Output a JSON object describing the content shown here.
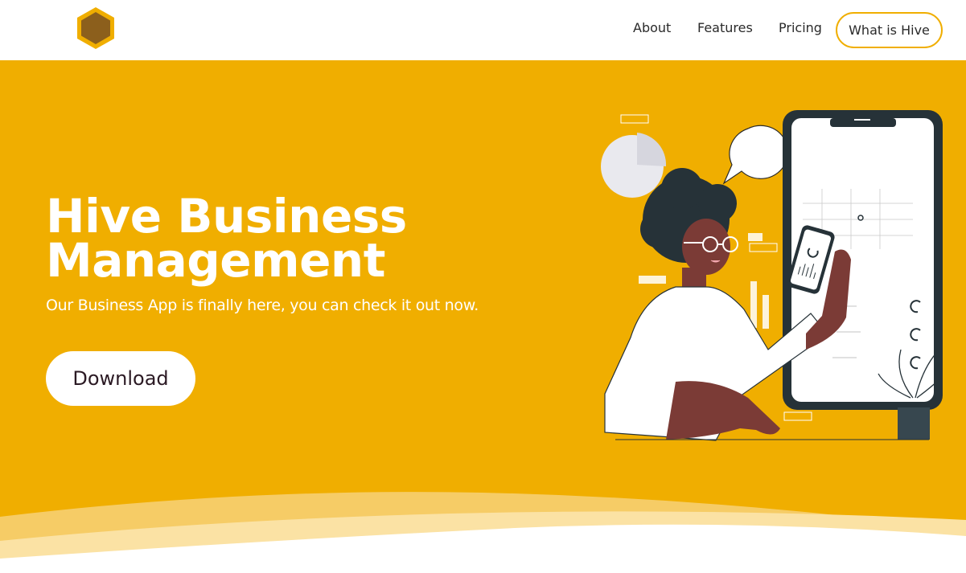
{
  "nav": {
    "links": [
      {
        "label": "About"
      },
      {
        "label": "Features"
      },
      {
        "label": "Pricing"
      }
    ],
    "cta_label": "What is Hive",
    "logo_icon": "hexagon-honeycomb-icon"
  },
  "hero": {
    "title_line1": "Hive Business",
    "title_line2": "Management",
    "subtitle": "Our Business App is finally here, you can check it out now.",
    "download_label": "Download",
    "illustration": "woman-holding-phone-illustration"
  },
  "colors": {
    "brand": "#f0ae00",
    "text_dark": "#2b1a24",
    "white": "#ffffff"
  }
}
